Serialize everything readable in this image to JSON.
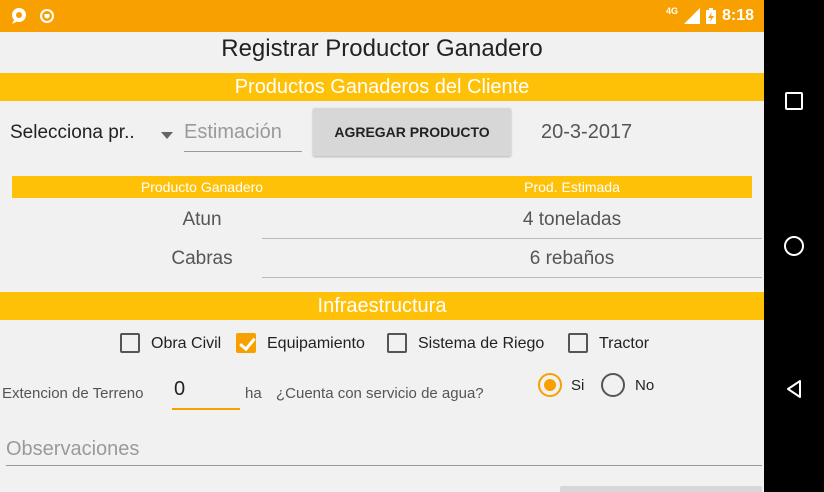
{
  "status_bar": {
    "time": "8:18",
    "network": "4G"
  },
  "title": "Registrar Productor Ganadero",
  "productos_header": "Productos Ganaderos del Cliente",
  "producto_spinner": "Selecciona pr..",
  "estimacion_placeholder": "Estimación",
  "agregar_button": "AGREGAR PRODUCTO",
  "date": "20-3-2017",
  "table": {
    "headers": [
      "Producto Ganadero",
      "Prod. Estimada"
    ],
    "rows": [
      {
        "producto": "Atun",
        "estimada": "4 toneladas"
      },
      {
        "producto": "Cabras",
        "estimada": "6 rebaños"
      }
    ]
  },
  "infraestructura_header": "Infraestructura",
  "checkboxes": [
    {
      "label": "Obra Civil",
      "checked": false
    },
    {
      "label": "Equipamiento",
      "checked": true
    },
    {
      "label": "Sistema de Riego",
      "checked": false
    },
    {
      "label": "Tractor",
      "checked": false
    }
  ],
  "terreno": {
    "label": "Extencion de Terreno",
    "value": "0",
    "unit": "ha"
  },
  "agua": {
    "question": "¿Cuenta con servicio de agua?",
    "options": [
      "Si",
      "No"
    ],
    "selected": "Si"
  },
  "observaciones_placeholder": "Observaciones",
  "colors": {
    "accent": "#f7a000",
    "band": "#ffc107"
  }
}
